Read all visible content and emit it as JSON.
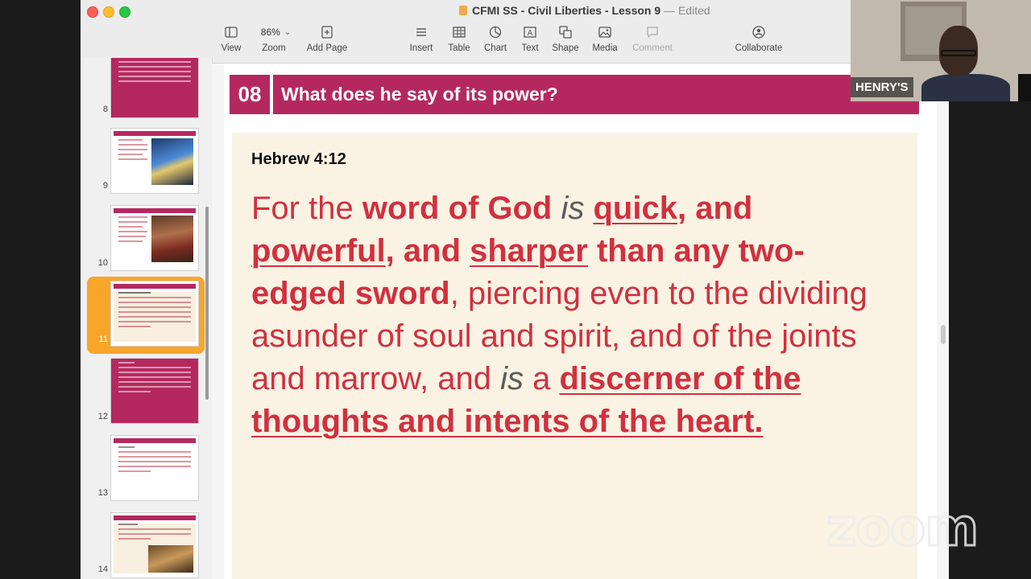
{
  "window": {
    "title_app": "CFMI SS - Civil Liberties - Lesson 9",
    "title_sep": " — ",
    "title_status": "Edited"
  },
  "toolbar": {
    "view": "View",
    "zoom_value": "86%",
    "zoom": "Zoom",
    "add_page": "Add Page",
    "insert": "Insert",
    "table": "Table",
    "chart": "Chart",
    "text": "Text",
    "shape": "Shape",
    "media": "Media",
    "comment": "Comment",
    "collaborate": "Collaborate"
  },
  "sidebar": {
    "slides": [
      {
        "num": "8",
        "style": "pink"
      },
      {
        "num": "9",
        "style": "image"
      },
      {
        "num": "10",
        "style": "image"
      },
      {
        "num": "11",
        "style": "text",
        "selected": true
      },
      {
        "num": "12",
        "style": "pink"
      },
      {
        "num": "13",
        "style": "text"
      },
      {
        "num": "14",
        "style": "image"
      }
    ]
  },
  "slide": {
    "number": "08",
    "heading": "What does he say of its power?",
    "reference": "Hebrew 4:12",
    "verse": {
      "p1": "For the ",
      "p2": "word of God",
      "p3": "is",
      "p4": "quick",
      "p5": ", and",
      "p6": "powerful",
      "p7": ", and ",
      "p8": "sharper",
      "p9": " than any two-edged sword",
      "p10": ", piercing even to the dividing asunder of soul and spirit, and of the joints and marrow, and ",
      "p11": "is",
      "p12": " a ",
      "p13": "discerner of the thoughts and intents of the heart."
    }
  },
  "video": {
    "participant_name": "HENRY'S",
    "watermark": "zoom"
  }
}
